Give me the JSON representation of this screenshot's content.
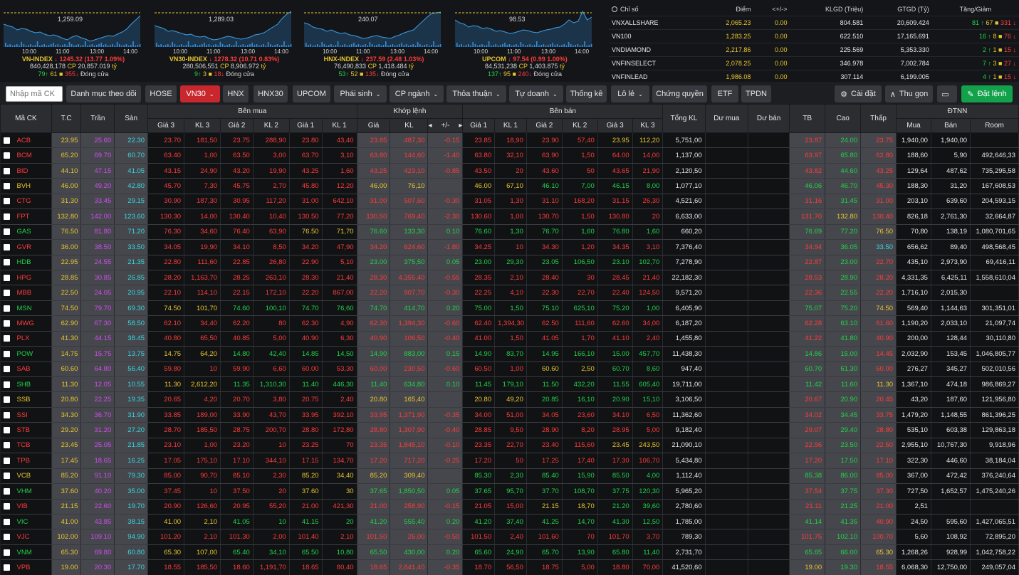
{
  "mini_charts": [
    {
      "name": "VN-INDEX",
      "arrow": "↓",
      "value": "1245.32",
      "chg": "(13.77",
      "pct": "1.09%)",
      "vol": "840,428,178",
      "val": "20,857.019",
      "up": "79",
      "ref": "61",
      "down": "355",
      "status": "Đóng cửa",
      "ref_label": "1,259.09",
      "times": [
        "10:00",
        "11:00",
        "13:00",
        "14:00"
      ]
    },
    {
      "name": "VN30-INDEX",
      "arrow": "↓",
      "value": "1278.32",
      "chg": "(10.71",
      "pct": "0.83%)",
      "vol": "280,506,551",
      "val": "8,906.972",
      "up": "9",
      "ref": "3",
      "down": "18",
      "status": "Đóng cửa",
      "ref_label": "1,289.03",
      "times": [
        "10:00",
        "11:00",
        "13:00",
        "14:00"
      ]
    },
    {
      "name": "HNX-INDEX",
      "arrow": "↓",
      "value": "237.59",
      "chg": "(2.48",
      "pct": "1.03%)",
      "vol": "76,490,833",
      "val": "1,418.484",
      "up": "53",
      "ref": "52",
      "down": "135",
      "status": "Đóng cửa",
      "ref_label": "240.07",
      "times": [
        "10:00",
        "11:00",
        "13:00",
        "14:00"
      ]
    },
    {
      "name": "UPCOM",
      "arrow": "↓",
      "value": "97.54",
      "chg": "(0.99",
      "pct": "1.00%)",
      "vol": "84,531,238",
      "val": "1,403.875",
      "up": "137",
      "ref": "95",
      "down": "240",
      "status": "Đóng cửa",
      "ref_label": "98.53",
      "times": [
        "10:00",
        "11:00",
        "13:00",
        "14:00"
      ]
    }
  ],
  "mini_labels": {
    "cp": "CP",
    "ty": "tỷ"
  },
  "index_table": {
    "headers": [
      "Chỉ số",
      "Điểm",
      "<+/->",
      "KLGD (Triệu)",
      "GTGD (Tỷ)",
      "Tăng/Giảm"
    ],
    "rows": [
      {
        "name": "VNXALLSHARE",
        "point": "2,065.23",
        "chg": "0.00",
        "vol": "804.581",
        "val": "20,609.424",
        "up": "81",
        "ref": "67",
        "down": "331"
      },
      {
        "name": "VN100",
        "point": "1,283.25",
        "chg": "0.00",
        "vol": "622.510",
        "val": "17,165.691",
        "up": "16",
        "ref": "8",
        "down": "76"
      },
      {
        "name": "VNDIAMOND",
        "point": "2,217.86",
        "chg": "0.00",
        "vol": "225.569",
        "val": "5,353.330",
        "up": "2",
        "ref": "1",
        "down": "15"
      },
      {
        "name": "VNFINSELECT",
        "point": "2,078.25",
        "chg": "0.00",
        "vol": "346.978",
        "val": "7,002.784",
        "up": "7",
        "ref": "3",
        "down": "27"
      },
      {
        "name": "VNFINLEAD",
        "point": "1,986.08",
        "chg": "0.00",
        "vol": "307.114",
        "val": "6,199.005",
        "up": "4",
        "ref": "1",
        "down": "15"
      }
    ]
  },
  "toolbar": {
    "search_placeholder": "Nhập mã CK",
    "buttons": [
      "Danh mục theo dõi",
      "HOSE",
      "VN30",
      "HNX",
      "HNX30",
      "UPCOM",
      "Phái sinh",
      "CP ngành",
      "Thỏa thuận",
      "Tự doanh",
      "Thống kê",
      "Lô lẻ",
      "Chứng quyền",
      "ETF",
      "TPDN"
    ],
    "settings": "Cài đặt",
    "collapse": "Thu gọn",
    "order": "Đặt lệnh"
  },
  "grid_headers": {
    "symbol": "Mã CK",
    "ref": "T.C",
    "ceil": "Trần",
    "floor": "Sàn",
    "buy": "Bên mua",
    "match": "Khớp lệnh",
    "sell": "Bên bán",
    "total": "Tổng KL",
    "bid_rem": "Dư mua",
    "ask_rem": "Dư bán",
    "avg": "TB",
    "high": "Cao",
    "low": "Thấp",
    "foreign": "ĐTNN",
    "p3": "Giá 3",
    "v3": "KL 3",
    "p2": "Giá 2",
    "v2": "KL 2",
    "p1": "Giá 1",
    "v1": "KL 1",
    "mp": "Giá",
    "mv": "KL",
    "mc": "+/-",
    "fb": "Mua",
    "fs": "Bán",
    "fr": "Room"
  },
  "rows": [
    [
      "ACB",
      "23.95",
      "25.60",
      "22.30",
      "23.70",
      "181,50",
      "23.75",
      "288,90",
      "23.80",
      "43,40",
      "23.85",
      "487,30",
      "-0.15",
      "23.85",
      "18,90",
      "23.90",
      "57,40",
      "23.95",
      "112,20",
      "5,751,00",
      "",
      "",
      "23.87",
      "24.00",
      "23.75",
      "1,940,00",
      "1,940,00",
      ""
    ],
    [
      "BCM",
      "65.20",
      "69.70",
      "60.70",
      "63.40",
      "1,00",
      "63.50",
      "3,00",
      "63.70",
      "3,10",
      "63.80",
      "144,60",
      "-1.40",
      "63.80",
      "32,10",
      "63.90",
      "1,50",
      "64.00",
      "14,00",
      "1,137,00",
      "",
      "",
      "63.97",
      "65.80",
      "62.80",
      "188,60",
      "5,90",
      "492,646,33"
    ],
    [
      "BID",
      "44.10",
      "47.15",
      "41.05",
      "43.15",
      "24,90",
      "43.20",
      "19,90",
      "43.25",
      "1,60",
      "43.25",
      "423,10",
      "-0.85",
      "43.50",
      "20",
      "43.60",
      "50",
      "43.65",
      "21,90",
      "2,120,50",
      "",
      "",
      "43.82",
      "44.60",
      "43.25",
      "129,64",
      "487,62",
      "735,295,58"
    ],
    [
      "BVH",
      "46.00",
      "49.20",
      "42.80",
      "45.70",
      "7,30",
      "45.75",
      "2,70",
      "45.80",
      "12,20",
      "46.00",
      "76,10",
      "",
      "46.00",
      "67,10",
      "46.10",
      "7,00",
      "46.15",
      "8,00",
      "1,077,10",
      "",
      "",
      "46.06",
      "46.70",
      "45.30",
      "188,30",
      "31,20",
      "167,608,53"
    ],
    [
      "CTG",
      "31.30",
      "33.45",
      "29.15",
      "30.90",
      "187,30",
      "30.95",
      "117,20",
      "31.00",
      "642,10",
      "31.00",
      "507,60",
      "-0.30",
      "31.05",
      "1,30",
      "31.10",
      "168,20",
      "31.15",
      "26,30",
      "4,521,60",
      "",
      "",
      "31.16",
      "31.45",
      "31.00",
      "203,10",
      "639,60",
      "204,593,15"
    ],
    [
      "FPT",
      "132.80",
      "142.00",
      "123.60",
      "130.30",
      "14,00",
      "130.40",
      "10,40",
      "130.50",
      "77,20",
      "130.50",
      "769,40",
      "-2.30",
      "130.60",
      "1,00",
      "130.70",
      "1,50",
      "130.80",
      "20",
      "6,633,00",
      "",
      "",
      "131.70",
      "132.80",
      "130.40",
      "826,18",
      "2,761,30",
      "32,664,87"
    ],
    [
      "GAS",
      "76.50",
      "81.80",
      "71.20",
      "76.30",
      "34,60",
      "76.40",
      "63,90",
      "76.50",
      "71,70",
      "76.60",
      "133,30",
      "0.10",
      "76.60",
      "1,30",
      "76.70",
      "1,60",
      "76.80",
      "1,60",
      "660,20",
      "",
      "",
      "76.69",
      "77.20",
      "76.50",
      "70,80",
      "138,19",
      "1,080,701,65"
    ],
    [
      "GVR",
      "36.00",
      "38.50",
      "33.50",
      "34.05",
      "19,90",
      "34.10",
      "8,50",
      "34.20",
      "47,90",
      "34.20",
      "624,60",
      "-1.80",
      "34.25",
      "10",
      "34.30",
      "1,20",
      "34.35",
      "3,10",
      "7,376,40",
      "",
      "",
      "34.94",
      "36.05",
      "33.50",
      "656,62",
      "89,40",
      "498,568,45"
    ],
    [
      "HDB",
      "22.95",
      "24.55",
      "21.35",
      "22.80",
      "111,60",
      "22.85",
      "26,80",
      "22.90",
      "5,10",
      "23.00",
      "375,50",
      "0.05",
      "23.00",
      "29,30",
      "23.05",
      "106,50",
      "23.10",
      "102,70",
      "7,278,90",
      "",
      "",
      "22.87",
      "23.00",
      "22.70",
      "435,10",
      "2,973,90",
      "69,416,11"
    ],
    [
      "HPG",
      "28.85",
      "30.85",
      "26.85",
      "28.20",
      "1,163,70",
      "28.25",
      "263,10",
      "28.30",
      "21,40",
      "28.30",
      "4,355,40",
      "-0.55",
      "28.35",
      "2,10",
      "28.40",
      "30",
      "28.45",
      "21,40",
      "22,182,30",
      "",
      "",
      "28.53",
      "28.90",
      "28.20",
      "4,331,35",
      "6,425,11",
      "1,558,610,04"
    ],
    [
      "MBB",
      "22.50",
      "24.05",
      "20.95",
      "22.10",
      "114,10",
      "22.15",
      "172,10",
      "22.20",
      "867,00",
      "22.20",
      "907,70",
      "-0.30",
      "22.25",
      "4,10",
      "22.30",
      "22,70",
      "22.40",
      "124,50",
      "9,571,20",
      "",
      "",
      "22.36",
      "22.55",
      "22.20",
      "1,716,10",
      "2,015,30",
      ""
    ],
    [
      "MSN",
      "74.50",
      "79.70",
      "69.30",
      "74.50",
      "101,70",
      "74.60",
      "100,10",
      "74.70",
      "76,60",
      "74.70",
      "414,70",
      "0.20",
      "75.00",
      "1,50",
      "75.10",
      "625,10",
      "75.20",
      "1,00",
      "6,405,90",
      "",
      "",
      "75.07",
      "75.20",
      "74.50",
      "569,40",
      "1,144,63",
      "301,351,01"
    ],
    [
      "MWG",
      "62.90",
      "67.30",
      "58.50",
      "62.10",
      "34,40",
      "62.20",
      "80",
      "62.30",
      "4,90",
      "62.30",
      "1,394,30",
      "-0.60",
      "62.40",
      "1,394,30",
      "62.50",
      "111,60",
      "62.60",
      "34,00",
      "6,187,20",
      "",
      "",
      "62.28",
      "63.10",
      "61.60",
      "1,190,20",
      "2,033,10",
      "21,097,74"
    ],
    [
      "PLX",
      "41.30",
      "44.15",
      "38.45",
      "40.80",
      "65,50",
      "40.85",
      "5,00",
      "40.90",
      "6,30",
      "40.90",
      "106,50",
      "-0.40",
      "41.00",
      "1,50",
      "41.05",
      "1,70",
      "41.10",
      "2,40",
      "1,455,80",
      "",
      "",
      "41.22",
      "41.80",
      "40.90",
      "200,00",
      "128,44",
      "30,110,80"
    ],
    [
      "POW",
      "14.75",
      "15.75",
      "13.75",
      "14.75",
      "64,20",
      "14.80",
      "42,40",
      "14.85",
      "14,50",
      "14.90",
      "883,00",
      "0.15",
      "14.90",
      "83,70",
      "14.95",
      "166,10",
      "15.00",
      "457,70",
      "11,438,30",
      "",
      "",
      "14.86",
      "15.00",
      "14.45",
      "2,032,90",
      "153,45",
      "1,046,805,77"
    ],
    [
      "SAB",
      "60.60",
      "64.80",
      "56.40",
      "59.80",
      "10",
      "59.90",
      "6,60",
      "60.00",
      "53,30",
      "60.00",
      "230,50",
      "-0.60",
      "60.50",
      "1,00",
      "60.60",
      "2,50",
      "60.70",
      "8,60",
      "947,40",
      "",
      "",
      "60.70",
      "61.30",
      "60.00",
      "276,27",
      "345,27",
      "502,010,56"
    ],
    [
      "SHB",
      "11.30",
      "12.05",
      "10.55",
      "11.30",
      "2,612,20",
      "11.35",
      "1,310,30",
      "11.40",
      "446,30",
      "11.40",
      "634,80",
      "0.10",
      "11.45",
      "179,10",
      "11.50",
      "432,20",
      "11.55",
      "605,40",
      "19,711,00",
      "",
      "",
      "11.42",
      "11.60",
      "11.30",
      "1,367,10",
      "474,18",
      "986,869,27"
    ],
    [
      "SSB",
      "20.80",
      "22.25",
      "19.35",
      "20.65",
      "4,20",
      "20.70",
      "3,80",
      "20.75",
      "2,40",
      "20.80",
      "165,40",
      "",
      "20.80",
      "49,20",
      "20.85",
      "16,10",
      "20.90",
      "15,10",
      "3,106,50",
      "",
      "",
      "20.67",
      "20.90",
      "20.45",
      "43,20",
      "187,60",
      "121,956,80"
    ],
    [
      "SSI",
      "34.30",
      "36.70",
      "31.90",
      "33.85",
      "189,00",
      "33.90",
      "43,70",
      "33.95",
      "392,10",
      "33.95",
      "1,371,90",
      "-0.35",
      "34.00",
      "51,00",
      "34.05",
      "23,60",
      "34.10",
      "6,50",
      "11,362,60",
      "",
      "",
      "34.02",
      "34.45",
      "33.75",
      "1,479,20",
      "1,148,55",
      "861,396,25"
    ],
    [
      "STB",
      "29.20",
      "31.20",
      "27.20",
      "28.70",
      "185,50",
      "28.75",
      "200,70",
      "28.80",
      "172,80",
      "28.80",
      "1,307,90",
      "-0.40",
      "28.85",
      "9,50",
      "28.90",
      "8,20",
      "28.95",
      "5,00",
      "9,182,40",
      "",
      "",
      "29.07",
      "29.40",
      "28.80",
      "535,10",
      "603,38",
      "129,863,18"
    ],
    [
      "TCB",
      "23.45",
      "25.05",
      "21.85",
      "23.10",
      "1,00",
      "23.20",
      "10",
      "23.25",
      "70",
      "23.35",
      "1,845,10",
      "-0.10",
      "23.35",
      "22,70",
      "23.40",
      "115,60",
      "23.45",
      "243,50",
      "21,090,10",
      "",
      "",
      "22.96",
      "23.50",
      "22.50",
      "2,955,10",
      "10,767,30",
      "9,918,96"
    ],
    [
      "TPB",
      "17.45",
      "18.65",
      "16.25",
      "17.05",
      "175,10",
      "17.10",
      "344,10",
      "17.15",
      "134,70",
      "17.20",
      "717,20",
      "-0.25",
      "17.20",
      "50",
      "17.25",
      "17,40",
      "17.30",
      "106,70",
      "5,434,80",
      "",
      "",
      "17.20",
      "17.50",
      "17.10",
      "322,30",
      "446,60",
      "38,184,04"
    ],
    [
      "VCB",
      "85.20",
      "91.10",
      "79.30",
      "85.00",
      "90,70",
      "85.10",
      "2,30",
      "85.20",
      "34,40",
      "85.20",
      "309,40",
      "",
      "85.30",
      "2,30",
      "85.40",
      "15,90",
      "85.50",
      "4,00",
      "1,112,40",
      "",
      "",
      "85.38",
      "86.00",
      "85.00",
      "367,00",
      "472,42",
      "376,240,64"
    ],
    [
      "VHM",
      "37.60",
      "40.20",
      "35.00",
      "37.45",
      "10",
      "37.50",
      "20",
      "37.60",
      "30",
      "37.65",
      "1,850,50",
      "0.05",
      "37.65",
      "95,70",
      "37.70",
      "108,70",
      "37.75",
      "120,30",
      "5,965,20",
      "",
      "",
      "37.54",
      "37.75",
      "37.30",
      "727,50",
      "1,652,57",
      "1,475,240,26"
    ],
    [
      "VIB",
      "21.15",
      "22.60",
      "19.70",
      "20.90",
      "126,60",
      "20.95",
      "55,20",
      "21.00",
      "421,30",
      "21.00",
      "258,90",
      "-0.15",
      "21.05",
      "15,00",
      "21.15",
      "18,70",
      "21.20",
      "39,60",
      "2,780,60",
      "",
      "",
      "21.11",
      "21.25",
      "21.00",
      "2,51",
      "",
      ""
    ],
    [
      "VIC",
      "41.00",
      "43.85",
      "38.15",
      "41.00",
      "2,10",
      "41.05",
      "10",
      "41.15",
      "20",
      "41.20",
      "555,40",
      "0.20",
      "41.20",
      "37,40",
      "41.25",
      "14,70",
      "41.30",
      "12,50",
      "1,785,00",
      "",
      "",
      "41.14",
      "41.35",
      "40.90",
      "24,50",
      "595,60",
      "1,427,065,51"
    ],
    [
      "VJC",
      "102.00",
      "109.10",
      "94.90",
      "101.20",
      "2,10",
      "101.30",
      "2,00",
      "101.40",
      "2,10",
      "101.50",
      "26,00",
      "-0.50",
      "101.50",
      "2,40",
      "101.60",
      "70",
      "101.70",
      "3,70",
      "789,30",
      "",
      "",
      "101.75",
      "102.10",
      "100.70",
      "5,60",
      "108,92",
      "72,895,20"
    ],
    [
      "VNM",
      "65.30",
      "69.80",
      "60.80",
      "65.30",
      "107,00",
      "65.40",
      "34,10",
      "65.50",
      "10,80",
      "65.50",
      "430,00",
      "0.20",
      "65.60",
      "24,90",
      "65.70",
      "13,90",
      "65.80",
      "11,40",
      "2,731,70",
      "",
      "",
      "65.65",
      "66.00",
      "65.30",
      "1,268,26",
      "928,99",
      "1,042,758,22"
    ],
    [
      "VPB",
      "19.00",
      "20.30",
      "17.70",
      "18.55",
      "185,50",
      "18.60",
      "1,191,70",
      "18.65",
      "80,40",
      "18.65",
      "2,641,40",
      "-0.35",
      "18.70",
      "56,50",
      "18.75",
      "5,00",
      "18.80",
      "70,00",
      "41,520,60",
      "",
      "",
      "19.00",
      "19.30",
      "18.55",
      "6,068,30",
      "12,750,00",
      "249,057,04"
    ]
  ]
}
